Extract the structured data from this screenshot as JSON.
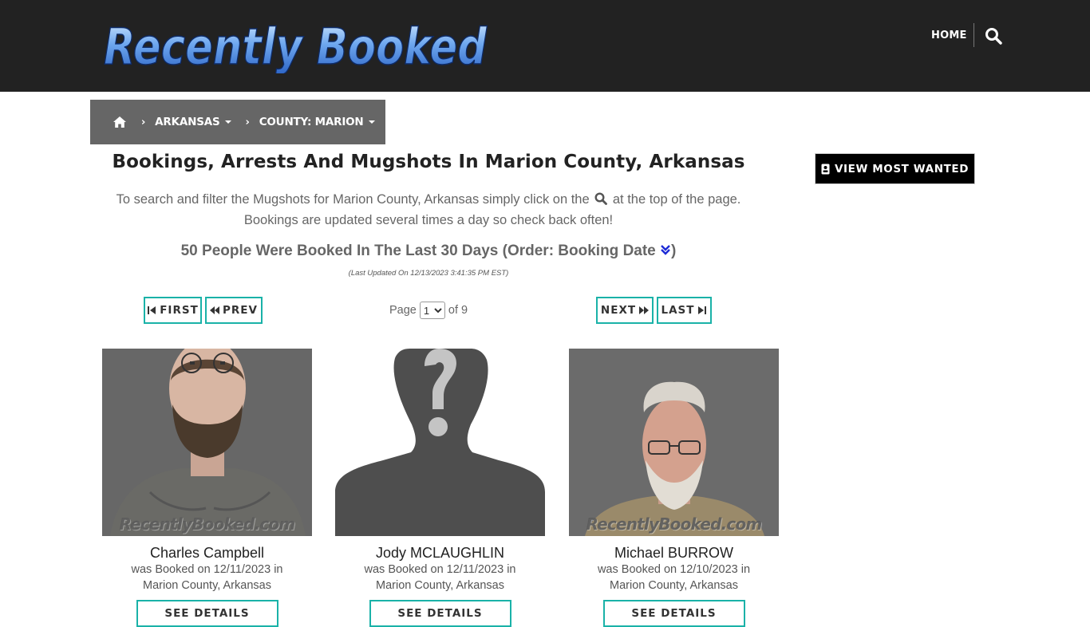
{
  "header": {
    "logo_text": "Recently Booked",
    "nav_home": "HOME",
    "search_icon": "search-icon"
  },
  "breadcrumb": {
    "home_icon": "home-icon",
    "items": [
      {
        "label": "ARKANSAS"
      },
      {
        "label": "COUNTY: MARION"
      }
    ]
  },
  "main": {
    "title": "Bookings, Arrests And Mugshots In Marion County, Arkansas",
    "intro_part1": "To search and filter the Mugshots for Marion County, Arkansas simply click on the",
    "intro_part2": "at the top of the page.",
    "intro_line2": "Bookings are updated several times a day so check back often!",
    "count_text": "50 People Were Booked In The Last 30 Days (Order: Booking Date",
    "count_close": ")",
    "updated": "(Last Updated On 12/13/2023 3:41:35 PM EST)"
  },
  "pagination": {
    "first": "FIRST",
    "prev": "PREV",
    "next": "NEXT",
    "last": "LAST",
    "page_label": "Page",
    "current_page": "1",
    "of_label": "of 9"
  },
  "sidebar": {
    "most_wanted": "VIEW MOST WANTED"
  },
  "watermark": "RecentlyBooked.com",
  "bookings": [
    {
      "name": "Charles Campbell",
      "line1": "was Booked on 12/11/2023 in",
      "line2": "Marion County, Arkansas",
      "button": "SEE DETAILS"
    },
    {
      "name": "Jody MCLAUGHLIN",
      "line1": "was Booked on 12/11/2023 in",
      "line2": "Marion County, Arkansas",
      "button": "SEE DETAILS"
    },
    {
      "name": "Michael BURROW",
      "line1": "was Booked on 12/10/2023 in",
      "line2": "Marion County, Arkansas",
      "button": "SEE DETAILS"
    }
  ],
  "colors": {
    "header_bg": "#222222",
    "breadcrumb_bg": "#666666",
    "button_border": "#1ab2a8",
    "most_wanted_bg": "#000000",
    "logo_blue": "#4f8fe0"
  }
}
